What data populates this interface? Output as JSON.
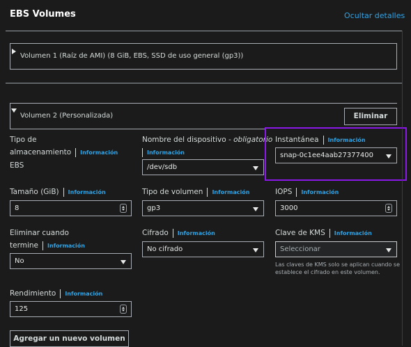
{
  "header": {
    "title": "EBS Volumes",
    "hide_details": "Ocultar detalles"
  },
  "volume1": {
    "label": "Volumen 1 (Raíz de AMI) (8 GiB, EBS, SSD de uso general (gp3))"
  },
  "volume2": {
    "label": "Volumen 2 (Personalizada)",
    "remove_button": "Eliminar",
    "storage_type": {
      "label_line1": "Tipo de",
      "label_line2": "almacenamiento",
      "info": "Información",
      "value": "EBS"
    },
    "device_name": {
      "label": "Nombre del dispositivo - ",
      "label_required": "obligatorio",
      "info": "Información",
      "value": "/dev/sdb"
    },
    "snapshot": {
      "label": "Instantánea",
      "info": "Información",
      "value": "snap-0c1ee4aab27377400"
    },
    "size": {
      "label": "Tamaño (GiB)",
      "info": "Información",
      "value": "8"
    },
    "volume_type": {
      "label": "Tipo de volumen",
      "info": "Información",
      "value": "gp3"
    },
    "iops": {
      "label": "IOPS",
      "info": "Información",
      "value": "3000"
    },
    "delete_on_termination": {
      "label_line1": "Eliminar cuando",
      "label_line2": "termine",
      "info": "Información",
      "value": "No"
    },
    "encrypted": {
      "label": "Cifrado",
      "info": "Información",
      "value": "No cifrado"
    },
    "kms_key": {
      "label": "Clave de KMS",
      "info": "Información",
      "value": "Seleccionar",
      "hint": "Las claves de KMS solo se aplican cuando se establece el cifrado en este volumen."
    },
    "throughput": {
      "label": "Rendimiento",
      "info": "Información",
      "value": "125"
    }
  },
  "add_volume_button": "Agregar un nuevo volumen",
  "colors": {
    "background": "#1b1b1b",
    "link": "#2fa4e7",
    "highlight": "#8a19e8"
  }
}
